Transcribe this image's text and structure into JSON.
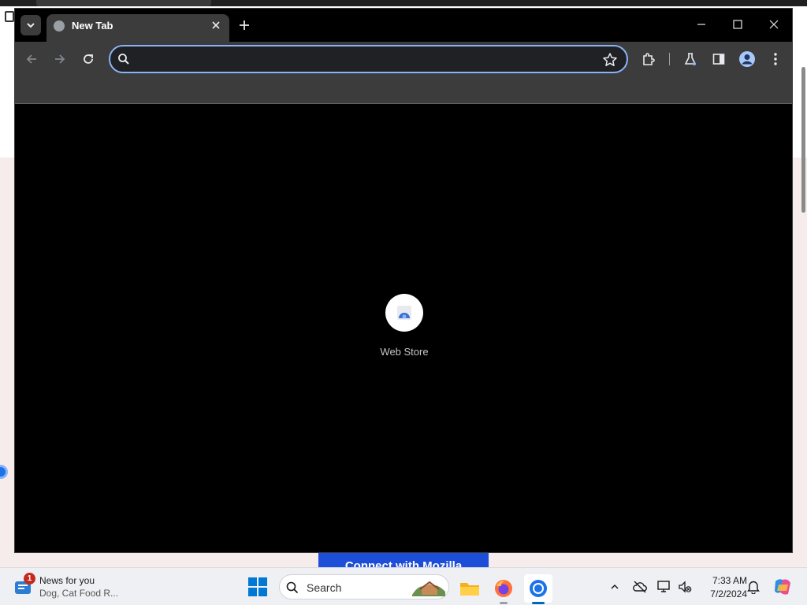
{
  "browser": {
    "tab": {
      "title": "New Tab"
    },
    "omnibox": {
      "value": "",
      "placeholder": ""
    },
    "shortcuts": [
      {
        "label": "Web Store"
      }
    ]
  },
  "background_page": {
    "button_label": "Connect with Mozilla"
  },
  "taskbar": {
    "news": {
      "badge": "1",
      "title": "News for you",
      "subtitle": "Dog, Cat Food R..."
    },
    "search_label": "Search",
    "clock": {
      "time": "7:33 AM",
      "date": "7/2/2024"
    }
  },
  "icons": {
    "tab_search": "chevron-down-icon",
    "favicon": "globe-icon",
    "close": "close-icon",
    "new_tab": "plus-icon",
    "back": "back-arrow-icon",
    "forward": "forward-arrow-icon",
    "reload": "reload-icon",
    "bookmark": "star-icon",
    "extensions": "puzzle-icon",
    "labs": "flask-icon",
    "side_panel": "side-panel-icon",
    "profile": "profile-icon",
    "menu": "kebab-menu-icon"
  },
  "colors": {
    "omnibox_focus": "#8ab4f8",
    "toolbar": "#3c3c3c",
    "content_bg": "#000000",
    "accent": "#0067c0"
  }
}
